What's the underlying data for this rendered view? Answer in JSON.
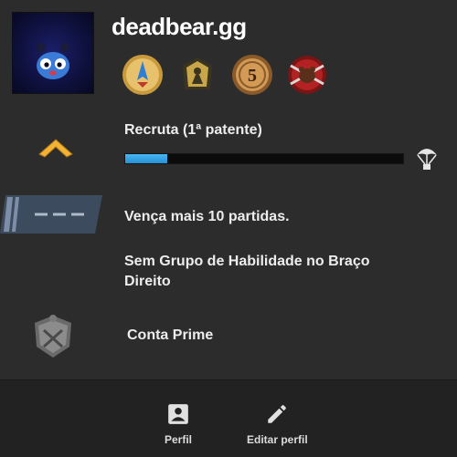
{
  "profile": {
    "username": "deadbear.gg",
    "medals": [
      "medal-blue-flame",
      "medal-soldier",
      "medal-5-year-coin",
      "medal-red-bear"
    ]
  },
  "rank": {
    "name": "Recruta (1ª patente)",
    "xp_progress": 0.15,
    "icon": "chevron-rank-icon",
    "reward_icon": "parachute-icon"
  },
  "rows": {
    "skill_group_wins": "Vença mais 10 partidas.",
    "wingman_group": "Sem Grupo de Habilidade no Braço Direito",
    "prime": "Conta Prime"
  },
  "nav": {
    "profile_label": "Perfil",
    "edit_profile_label": "Editar perfil"
  },
  "colors": {
    "xp_fill": "#3aa8ea",
    "rank_chevron": "#f2b233",
    "background": "#2c2c2c"
  }
}
